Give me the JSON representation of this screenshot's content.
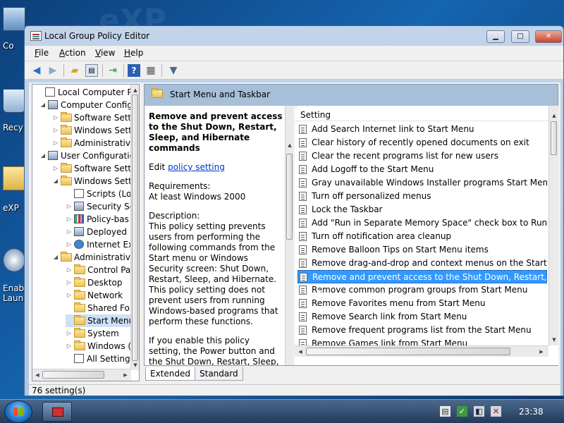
{
  "desktop": {
    "icons": [
      {
        "label": "Co",
        "icon": "computer-icon"
      },
      {
        "label": "Recy",
        "icon": "recycle-bin-icon"
      },
      {
        "label": "eXP",
        "icon": "folder-icon"
      },
      {
        "label": "Enab\nLaun",
        "icon": "shortcut-icon"
      }
    ]
  },
  "window": {
    "title": "Local Group Policy Editor",
    "controls": {
      "minimize": "▁",
      "maximize": "□",
      "close": "✕"
    }
  },
  "menu": [
    "File",
    "Action",
    "View",
    "Help"
  ],
  "toolbar": [
    "back-arrow-icon",
    "forward-arrow-icon",
    "up-folder-icon",
    "show-hide-tree-icon",
    "export-list-icon",
    "help-icon",
    "properties-icon",
    "filter-icon"
  ],
  "tree": {
    "items": [
      {
        "label": "Local Computer Polic",
        "indent": 0,
        "icon": "doc",
        "expander": ""
      },
      {
        "label": "Computer Config",
        "indent": 1,
        "icon": "computer",
        "expander": "◢"
      },
      {
        "label": "Software Setti",
        "indent": 2,
        "icon": "folder",
        "expander": "▷"
      },
      {
        "label": "Windows Sett",
        "indent": 2,
        "icon": "folder",
        "expander": "▷"
      },
      {
        "label": "Administrativ",
        "indent": 2,
        "icon": "folder",
        "expander": "▷"
      },
      {
        "label": "User Configuratio",
        "indent": 1,
        "icon": "users",
        "expander": "◢"
      },
      {
        "label": "Software Setti",
        "indent": 2,
        "icon": "folder",
        "expander": "▷"
      },
      {
        "label": "Windows Sett",
        "indent": 2,
        "icon": "folder",
        "expander": "◢"
      },
      {
        "label": "Scripts (Lo",
        "indent": 3,
        "icon": "doc",
        "expander": ""
      },
      {
        "label": "Security Se",
        "indent": 3,
        "icon": "shield",
        "expander": "▷"
      },
      {
        "label": "Policy-bas",
        "indent": 3,
        "icon": "chart",
        "expander": "▷"
      },
      {
        "label": "Deployed",
        "indent": 3,
        "icon": "printer",
        "expander": "▷"
      },
      {
        "label": "Internet Ex",
        "indent": 3,
        "icon": "ie",
        "expander": "▷"
      },
      {
        "label": "Administrative",
        "indent": 2,
        "icon": "folder",
        "expander": "◢"
      },
      {
        "label": "Control Pa",
        "indent": 3,
        "icon": "folder",
        "expander": "▷"
      },
      {
        "label": "Desktop",
        "indent": 3,
        "icon": "folder",
        "expander": "▷"
      },
      {
        "label": "Network",
        "indent": 3,
        "icon": "folder",
        "expander": "▷"
      },
      {
        "label": "Shared Fol",
        "indent": 3,
        "icon": "folder",
        "expander": ""
      },
      {
        "label": "Start Menu",
        "indent": 3,
        "icon": "folder",
        "expander": "",
        "selected": true
      },
      {
        "label": "System",
        "indent": 3,
        "icon": "folder",
        "expander": "▷"
      },
      {
        "label": "Windows (",
        "indent": 3,
        "icon": "folder",
        "expander": "▷"
      },
      {
        "label": "All Setting",
        "indent": 3,
        "icon": "doc",
        "expander": ""
      }
    ]
  },
  "pane": {
    "header_title": "Start Menu and Taskbar",
    "column_header": "Setting"
  },
  "description": {
    "title": "Remove and prevent access to the Shut Down, Restart, Sleep, and Hibernate commands",
    "edit_prefix": "Edit ",
    "edit_link": "policy setting",
    "requirements_label": "Requirements:",
    "requirements_value": "At least Windows 2000",
    "description_label": "Description:",
    "description_text": "This policy setting prevents users from performing the following commands from the Start menu or Windows Security screen: Shut Down, Restart, Sleep, and Hibernate. This policy setting does not prevent users from running Windows-based programs that perform these functions.",
    "description_more": "If you enable this policy setting, the Power button and the Shut Down, Restart, Sleep, and"
  },
  "settings": [
    "Add Search Internet link to Start Menu",
    "Clear history of recently opened documents on exit",
    "Clear the recent programs list for new users",
    "Add Logoff to the Start Menu",
    "Gray unavailable Windows Installer programs Start Menu sh...",
    "Turn off personalized menus",
    "Lock the Taskbar",
    "Add \"Run in Separate Memory Space\" check box to Run dial...",
    "Turn off notification area cleanup",
    "Remove Balloon Tips on Start Menu items",
    "Remove drag-and-drop and context menus on the Start Me...",
    "Remove and prevent access to the Shut Down, Restart, Sleep...",
    "Remove common program groups from Start Menu",
    "Remove Favorites menu from Start Menu",
    "Remove Search link from Start Menu",
    "Remove frequent programs list from the Start Menu",
    "Remove Games link from Start Menu"
  ],
  "selected_setting_index": 11,
  "tabs": [
    "Extended",
    "Standard"
  ],
  "active_tab": "Extended",
  "status": "76 setting(s)",
  "taskbar": {
    "clock": "23:38",
    "tray_icons": [
      "action-center-icon",
      "network-icon",
      "volume-icon",
      "power-icon"
    ]
  }
}
